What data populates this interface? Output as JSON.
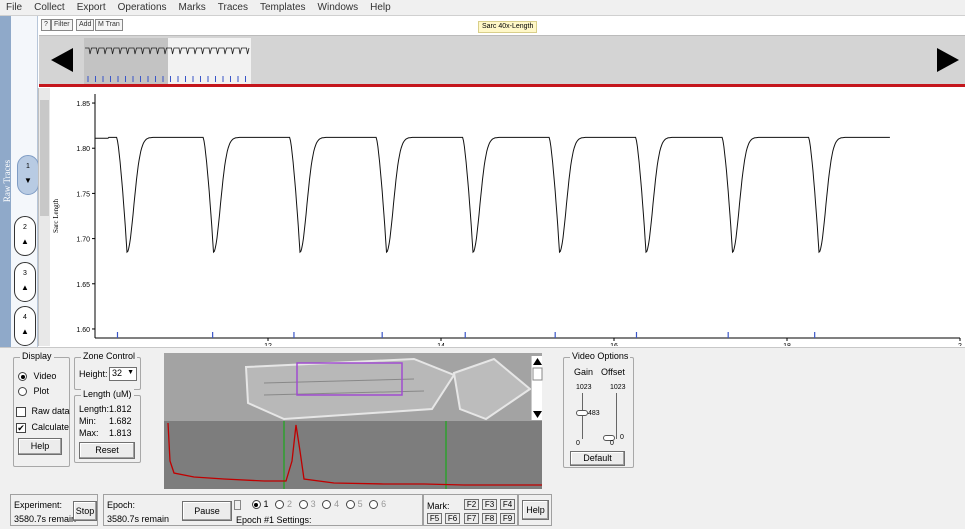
{
  "menu": [
    "File",
    "Collect",
    "Export",
    "Operations",
    "Marks",
    "Traces",
    "Templates",
    "Windows",
    "Help"
  ],
  "toolbar": {
    "help_btn": "?",
    "filter_btn": "Filter",
    "add_btn": "Add",
    "mtran_btn": "M Tran"
  },
  "segment_label": "Sarc 40x-Length",
  "side_tab_label": "Raw Traces",
  "trace_buttons": [
    {
      "num": "1",
      "arrow": "▼"
    },
    {
      "num": "2",
      "arrow": "▲"
    },
    {
      "num": "3",
      "arrow": "▲"
    },
    {
      "num": "4",
      "arrow": "▲"
    }
  ],
  "chart_data": {
    "type": "line",
    "title": "",
    "xlabel": "",
    "ylabel": "Sarc Length",
    "xlim": [
      10,
      20
    ],
    "ylim": [
      1.59,
      1.86
    ],
    "yticks": [
      "1.85",
      "1.80",
      "1.75",
      "1.70",
      "1.65",
      "1.60"
    ],
    "xticks": [
      "12",
      "14",
      "16",
      "18",
      "2"
    ],
    "series": [
      {
        "baseline": 1.812,
        "trough": 1.685,
        "trace_start": 10.0,
        "trace_end": 19.2,
        "beat_times": [
          10.3,
          11.3,
          12.3,
          13.3,
          14.3,
          15.3,
          16.3,
          17.3,
          18.3
        ],
        "trough_times": [
          10.37,
          11.37,
          12.37,
          13.37,
          14.37,
          15.37,
          16.37,
          17.37,
          18.37
        ]
      }
    ],
    "marker_times": [
      10.26,
      11.36,
      12.3,
      13.32,
      14.28,
      15.32,
      16.26,
      17.32,
      18.32
    ]
  },
  "display": {
    "title": "Display",
    "video": "Video",
    "plot": "Plot",
    "raw_data": "Raw data",
    "calculate": "Calculate",
    "help": "Help"
  },
  "zone_control": {
    "title": "Zone Control",
    "height_label": "Height:",
    "height_value": "32"
  },
  "length_group": {
    "title": "Length (uM)",
    "length_label": "Length:",
    "length_value": "1.812",
    "min_label": "Min:",
    "min_value": "1.682",
    "max_label": "Max:",
    "max_value": "1.813",
    "reset": "Reset"
  },
  "video_options": {
    "title": "Video Options",
    "gain": "Gain",
    "offset": "Offset",
    "gain_max": "1023",
    "gain_value": "483",
    "gain_min": "0",
    "offset_max": "1023",
    "offset_value": "0",
    "offset_min": "0",
    "default_btn": "Default"
  },
  "status": {
    "experiment_label": "Experiment:",
    "experiment_remain": "3580.7s remain",
    "stop": "Stop",
    "epoch_label": "Epoch:",
    "epoch_remain": "3580.7s remain",
    "pause": "Pause",
    "epochs": [
      "1",
      "2",
      "3",
      "4",
      "5",
      "6"
    ],
    "epoch_settings": "Epoch #1 Settings:",
    "mark_label": "Mark:",
    "fkeys": [
      "F2",
      "F3",
      "F4",
      "F5",
      "F6",
      "F7",
      "F8",
      "F9"
    ],
    "help": "Help"
  },
  "colors": {
    "accent_red": "#c4161c",
    "tab_blue": "#8fa9c9",
    "profile_red": "#c00000",
    "profile_green": "#2ea02e"
  }
}
